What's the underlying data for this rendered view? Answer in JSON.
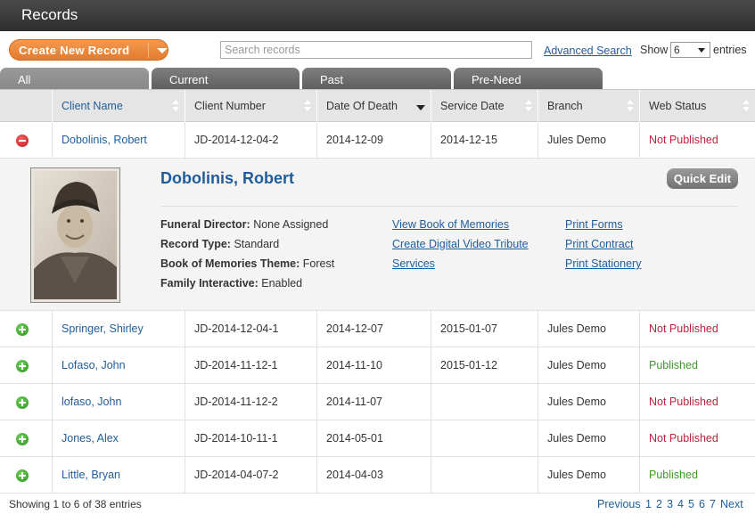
{
  "header": {
    "title": "Records"
  },
  "toolbar": {
    "create_label": "Create New Record",
    "search_placeholder": "Search records",
    "advanced_search": "Advanced Search",
    "show_label": "Show",
    "show_value": "6",
    "entries_label": "entries"
  },
  "tabs": [
    {
      "label": "All"
    },
    {
      "label": "Current"
    },
    {
      "label": "Past"
    },
    {
      "label": "Pre-Need"
    }
  ],
  "columns": {
    "client_name": "Client Name",
    "client_number": "Client Number",
    "date_of_death": "Date Of Death",
    "service_date": "Service Date",
    "branch": "Branch",
    "web_status": "Web Status"
  },
  "rows": [
    {
      "name": "Dobolinis, Robert",
      "number": "JD-2014-12-04-2",
      "dod": "2014-12-09",
      "service": "2014-12-15",
      "branch": "Jules Demo",
      "status": "Not Published"
    },
    {
      "name": "Springer, Shirley",
      "number": "JD-2014-12-04-1",
      "dod": "2014-12-07",
      "service": "2015-01-07",
      "branch": "Jules Demo",
      "status": "Not Published"
    },
    {
      "name": "Lofaso, John",
      "number": "JD-2014-11-12-1",
      "dod": "2014-11-10",
      "service": "2015-01-12",
      "branch": "Jules Demo",
      "status": "Published"
    },
    {
      "name": "lofaso, John",
      "number": "JD-2014-11-12-2",
      "dod": "2014-11-07",
      "service": "",
      "branch": "Jules Demo",
      "status": "Not Published"
    },
    {
      "name": "Jones, Alex",
      "number": "JD-2014-10-11-1",
      "dod": "2014-05-01",
      "service": "",
      "branch": "Jules Demo",
      "status": "Not Published"
    },
    {
      "name": "Little, Bryan",
      "number": "JD-2014-04-07-2",
      "dod": "2014-04-03",
      "service": "",
      "branch": "Jules Demo",
      "status": "Published"
    }
  ],
  "detail": {
    "name": "Dobolinis, Robert",
    "quick_edit": "Quick Edit",
    "fields": [
      {
        "label": "Funeral Director:",
        "value": "None Assigned"
      },
      {
        "label": "Record Type:",
        "value": "Standard"
      },
      {
        "label": "Book of Memories Theme:",
        "value": "Forest"
      },
      {
        "label": "Family Interactive:",
        "value": "Enabled"
      }
    ],
    "links_col1": [
      "View Book of Memories",
      "Create Digital Video Tribute",
      "Services"
    ],
    "links_col2": [
      "Print Forms",
      "Print Contract",
      "Print Stationery"
    ]
  },
  "footer": {
    "showing": "Showing 1 to 6 of 38 entries",
    "previous": "Previous",
    "pages": [
      "1",
      "2",
      "3",
      "4",
      "5",
      "6",
      "7"
    ],
    "next": "Next"
  },
  "colors": {
    "link": "#1f5d9a",
    "not_published": "#c0223b",
    "published": "#3c9a2a",
    "accent": "#e57a2c"
  }
}
